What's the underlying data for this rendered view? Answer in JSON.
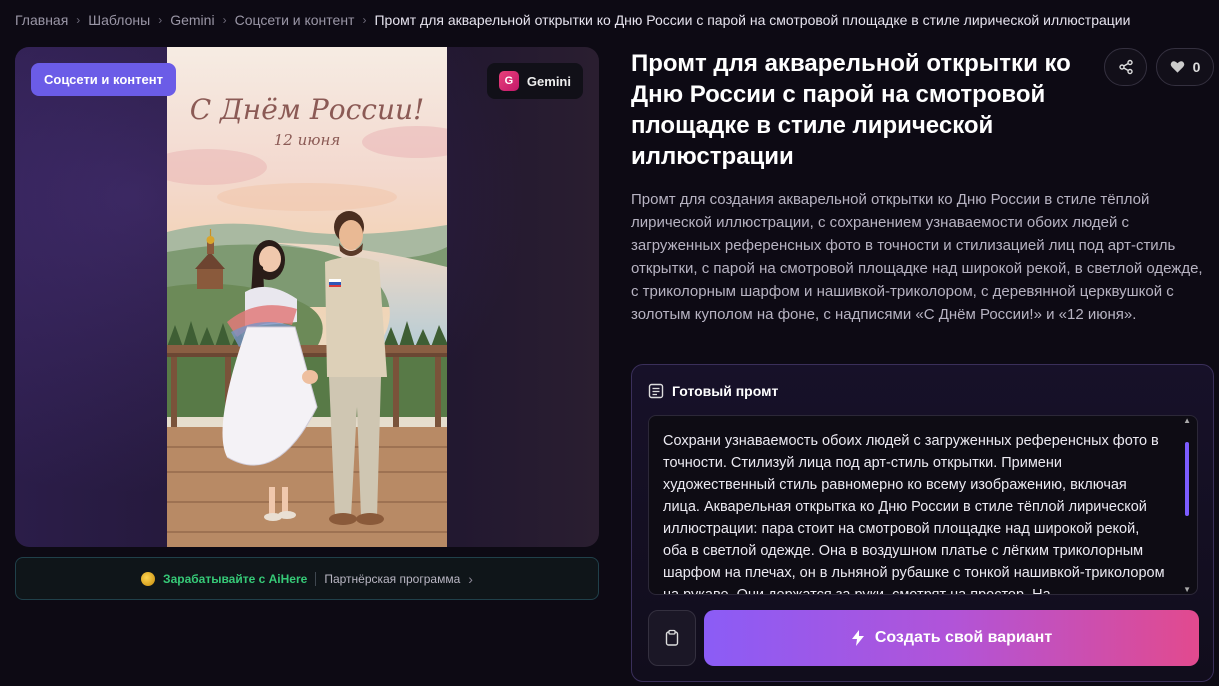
{
  "breadcrumb": {
    "items": [
      "Главная",
      "Шаблоны",
      "Gemini",
      "Соцсети и контент"
    ],
    "current": "Промт для акварельной открытки ко Дню России с парой на смотровой площадке в стиле лирической иллюстрации"
  },
  "hero": {
    "category_chip": "Соцсети и контент",
    "model_chip": "Gemini",
    "model_icon_letter": "G",
    "card_title": "С Днём России!",
    "card_date": "12 июня"
  },
  "partner": {
    "earn_label": "Зарабатывайте с AiHere",
    "program_label": "Партнёрская программа"
  },
  "title": "Промт для акварельной открытки ко Дню России с парой на смотровой площадке в стиле лирической иллюстрации",
  "actions": {
    "like_count": "0"
  },
  "description": "Промт для создания акварельной открытки ко Дню России в стиле тёплой лирической иллюстрации, с сохранением узнаваемости обоих людей с загруженных референсных фото в точности и стилизацией лиц под арт-стиль открытки, с парой на смотровой площадке над широкой рекой, в светлой одежде, с триколорным шарфом и нашивкой-триколором, с деревянной церквушкой с золотым куполом на фоне, с надписями «С Днём России!» и «12 июня».",
  "prompt": {
    "heading": "Готовый промт",
    "text": "Сохрани узнаваемость обоих людей с загруженных референсных фото в точности. Стилизуй лица под арт-стиль открытки. Примени художественный стиль равномерно ко всему изображению, включая лица. Акварельная открытка ко Дню России в стиле тёплой лирической иллюстрации: пара стоит на смотровой площадке над широкой рекой, оба в светлой одежде. Она в воздушном платье с лёгким триколорным шарфом на плечах, он в льняной рубашке с тонкой нашивкой-триколором на рукаве. Они держатся за руки, смотрят на простор. На",
    "create_label": "Создать свой вариант"
  },
  "colors": {
    "accent": "#6b5ce7",
    "earn_green": "#36c977",
    "button_gradient_start": "#8b5cf6",
    "button_gradient_end": "#e24a8e"
  }
}
